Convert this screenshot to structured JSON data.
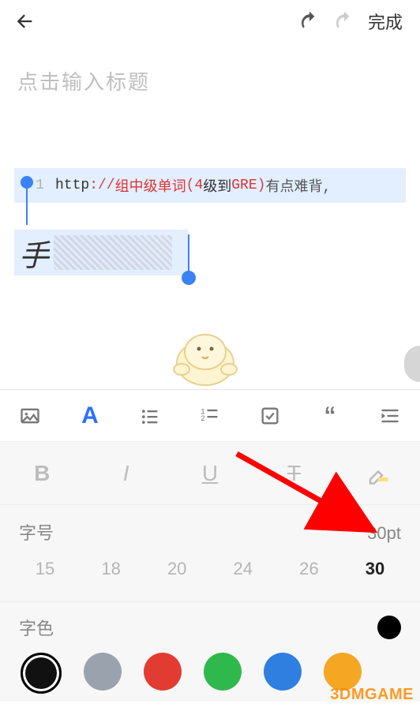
{
  "toolbar": {
    "done_label": "完成"
  },
  "title": {
    "placeholder": "点击输入标题"
  },
  "code": {
    "line_no": "1",
    "t1": "http",
    "t2": "://",
    "t3": "组中级单词",
    "t4": "(",
    "t5": "4",
    "t6": "级到",
    "t7": "GRE",
    "t8": ")",
    "t9": "  有点难背,"
  },
  "hand": {
    "char": "手"
  },
  "font_size": {
    "label": "字号",
    "current": "30pt",
    "options": [
      "15",
      "18",
      "20",
      "24",
      "26",
      "30"
    ],
    "selected": "30"
  },
  "font_color": {
    "label": "字色",
    "current": "#000000",
    "options": [
      {
        "name": "black",
        "hex": "#111111",
        "selected": true
      },
      {
        "name": "gray",
        "hex": "#9aa3ad",
        "selected": false
      },
      {
        "name": "red",
        "hex": "#e23b32",
        "selected": false
      },
      {
        "name": "green",
        "hex": "#2fb84c",
        "selected": false
      },
      {
        "name": "blue",
        "hex": "#2e7fe0",
        "selected": false
      },
      {
        "name": "orange",
        "hex": "#f5a623",
        "selected": false
      }
    ]
  },
  "watermark": "3DMGAME"
}
